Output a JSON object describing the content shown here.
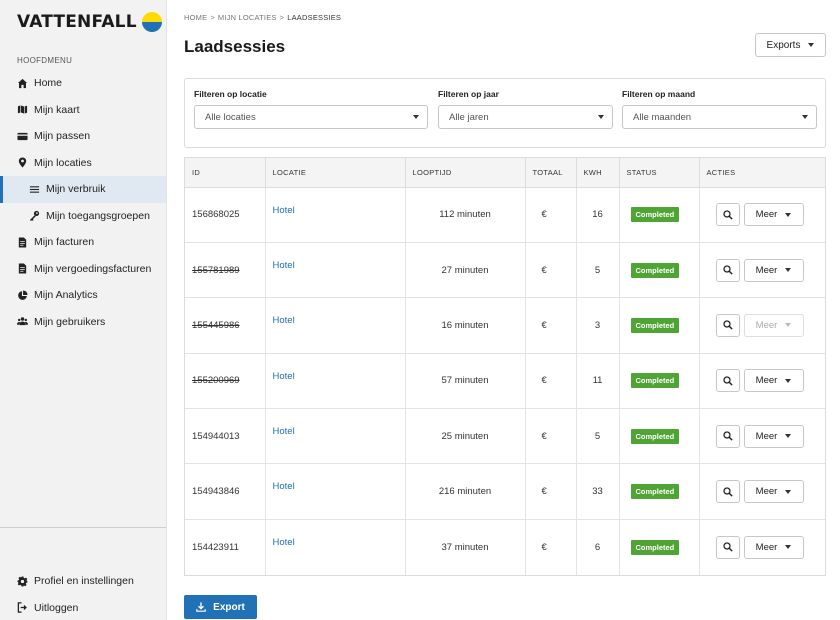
{
  "brand": {
    "name": "VATTENFALL",
    "colors": {
      "yellow": "#ffda00",
      "blue": "#2071b5",
      "green": "#4fa534"
    }
  },
  "sidebar": {
    "heading": "HOOFDMENU",
    "items": [
      {
        "label": "Home",
        "icon": "home-icon"
      },
      {
        "label": "Mijn kaart",
        "icon": "map-icon"
      },
      {
        "label": "Mijn passen",
        "icon": "card-icon"
      },
      {
        "label": "Mijn locaties",
        "icon": "location-icon"
      },
      {
        "label": "Mijn verbruik",
        "icon": "list-icon",
        "active": true
      },
      {
        "label": "Mijn toegangsgroepen",
        "icon": "key-icon"
      },
      {
        "label": "Mijn facturen",
        "icon": "document-icon"
      },
      {
        "label": "Mijn vergoedingsfacturen",
        "icon": "document-icon"
      },
      {
        "label": "Mijn Analytics",
        "icon": "pie-chart-icon"
      },
      {
        "label": "Mijn gebruikers",
        "icon": "users-icon"
      }
    ],
    "bottom": [
      {
        "label": "Profiel en instellingen",
        "icon": "gear-icon"
      },
      {
        "label": "Uitloggen",
        "icon": "logout-icon"
      }
    ]
  },
  "breadcrumb": {
    "home": "HOME",
    "locations": "MIJN LOCATIES",
    "current": "LAADSESSIES",
    "separator": ">"
  },
  "page": {
    "title": "Laadsessies",
    "exports_label": "Exports",
    "export_button": "Export"
  },
  "filters": {
    "location": {
      "label": "Filteren op locatie",
      "value": "Alle locaties"
    },
    "year": {
      "label": "Filteren op jaar",
      "value": "Alle jaren"
    },
    "month": {
      "label": "Filteren op maand",
      "value": "Alle maanden"
    }
  },
  "table": {
    "headers": {
      "id": "ID",
      "location": "LOCATIE",
      "duration": "LOOPTIJD",
      "total": "TOTAAL",
      "kwh": "KWH",
      "status": "STATUS",
      "actions": "ACTIES"
    },
    "more_label": "Meer",
    "rows": [
      {
        "id": "156868025",
        "location": "Hotel",
        "duration": "112 minuten",
        "total": "€",
        "kwh": "16",
        "status": "Completed",
        "struck": false,
        "more_disabled": false
      },
      {
        "id": "155781989",
        "location": "Hotel",
        "duration": "27 minuten",
        "total": "€",
        "kwh": "5",
        "status": "Completed",
        "struck": true,
        "more_disabled": false
      },
      {
        "id": "155445986",
        "location": "Hotel",
        "duration": "16 minuten",
        "total": "€",
        "kwh": "3",
        "status": "Completed",
        "struck": true,
        "more_disabled": true
      },
      {
        "id": "155200969",
        "location": "Hotel",
        "duration": "57 minuten",
        "total": "€",
        "kwh": "11",
        "status": "Completed",
        "struck": true,
        "more_disabled": false
      },
      {
        "id": "154944013",
        "location": "Hotel",
        "duration": "25 minuten",
        "total": "€",
        "kwh": "5",
        "status": "Completed",
        "struck": false,
        "more_disabled": false
      },
      {
        "id": "154943846",
        "location": "Hotel",
        "duration": "216 minuten",
        "total": "€",
        "kwh": "33",
        "status": "Completed",
        "struck": false,
        "more_disabled": false
      },
      {
        "id": "154423911",
        "location": "Hotel",
        "duration": "37 minuten",
        "total": "€",
        "kwh": "6",
        "status": "Completed",
        "struck": false,
        "more_disabled": false
      }
    ]
  }
}
